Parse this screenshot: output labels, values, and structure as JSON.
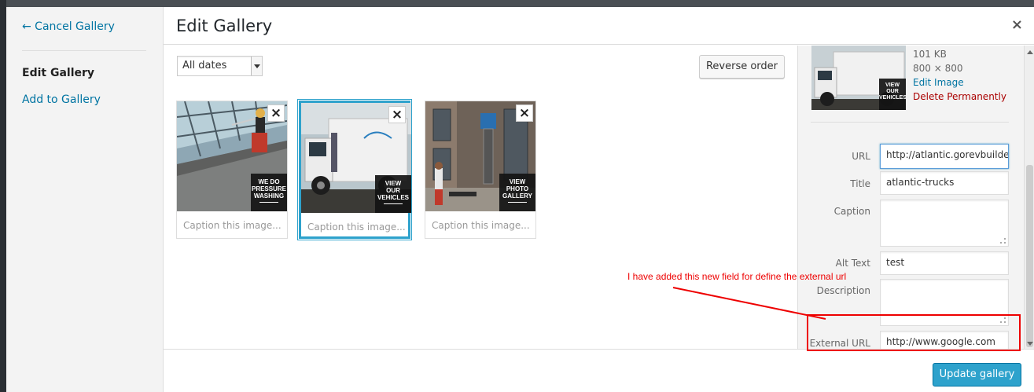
{
  "menu": {
    "cancel_label": "← Cancel Gallery",
    "edit_label": "Edit Gallery",
    "add_label": "Add to Gallery"
  },
  "header": {
    "title": "Edit Gallery",
    "close_glyph": "×"
  },
  "toolbar": {
    "date_filter": "All dates",
    "reverse_label": "Reverse order"
  },
  "gallery": {
    "items": [
      {
        "caption_placeholder": "Caption this image...",
        "badge": [
          "WE DO",
          "PRESSURE",
          "WASHING"
        ],
        "remove_glyph": "×"
      },
      {
        "caption_placeholder": "Caption this image...",
        "badge": [
          "VIEW",
          "OUR",
          "VEHICLES"
        ],
        "remove_glyph": "×"
      },
      {
        "caption_placeholder": "Caption this image...",
        "badge": [
          "VIEW",
          "PHOTO",
          "GALLERY"
        ],
        "remove_glyph": "×"
      }
    ]
  },
  "details": {
    "preview_badge": [
      "VIEW",
      "OUR",
      "VEHICLES"
    ],
    "file_size": "101 KB",
    "dimensions": "800 × 800",
    "edit_image": "Edit Image",
    "delete": "Delete Permanently",
    "url_label": "URL",
    "url_value": "http://atlantic.gorevbuilder",
    "title_label": "Title",
    "title_value": "atlantic-trucks",
    "caption_label": "Caption",
    "alt_label": "Alt Text",
    "alt_value": "test",
    "description_label": "Description",
    "external_url_label": "External URL",
    "external_url_value": "http://www.google.com"
  },
  "footer": {
    "update_label": "Update gallery"
  },
  "annotation": {
    "text": "I have added this new field for define the external url",
    "color": "#e00000"
  },
  "colors": {
    "link": "#0074a2",
    "primary": "#2ea2cc",
    "danger": "#aa0000"
  }
}
